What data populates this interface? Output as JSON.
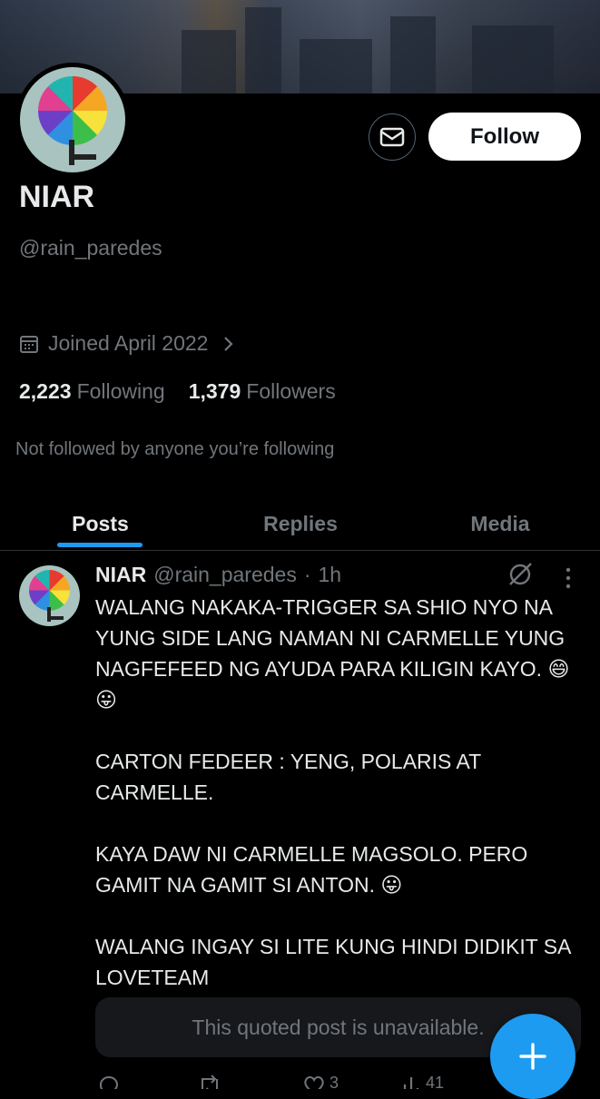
{
  "profile": {
    "name": "NIAR",
    "handle": "@rain_paredes",
    "joined": "Joined April 2022",
    "following_count": "2,223",
    "following_label": "Following",
    "followers_count": "1,379",
    "followers_label": "Followers",
    "not_followed": "Not followed by anyone you’re following",
    "follow_label": "Follow"
  },
  "tabs": [
    {
      "label": "Posts",
      "active": true
    },
    {
      "label": "Replies",
      "active": false
    },
    {
      "label": "Media",
      "active": false
    }
  ],
  "post": {
    "name": "NIAR",
    "handle": "@rain_paredes",
    "separator": "·",
    "time": "1h",
    "body": "WALANG NAKAKA-TRIGGER SA SHIO NYO NA YUNG SIDE LANG NAMAN NI CARMELLE YUNG NAGFEFEED NG AYUDA PARA KILIGIN KAYO. 😄😛\n\nCARTON FEDEER : YENG, POLARIS AT CARMELLE.\n\nKAYA DAW NI CARMELLE MAGSOLO. PERO GAMIT NA GAMIT SI ANTON. 😛\n\nWALANG INGAY SI LITE KUNG HINDI DIDIKIT SA LOVETEAM",
    "quoted": "This quoted post is unavailable.",
    "likes": "3",
    "views": "41"
  },
  "colors": {
    "accent": "#1d9bf0",
    "background": "#000000",
    "muted": "#71767b",
    "text": "#e7e9ea"
  },
  "icons": [
    "message-icon",
    "calendar-icon",
    "chevron-right-icon",
    "grok-icon",
    "more-icon",
    "plus-icon",
    "reply-icon",
    "repost-icon",
    "like-icon",
    "views-icon"
  ]
}
